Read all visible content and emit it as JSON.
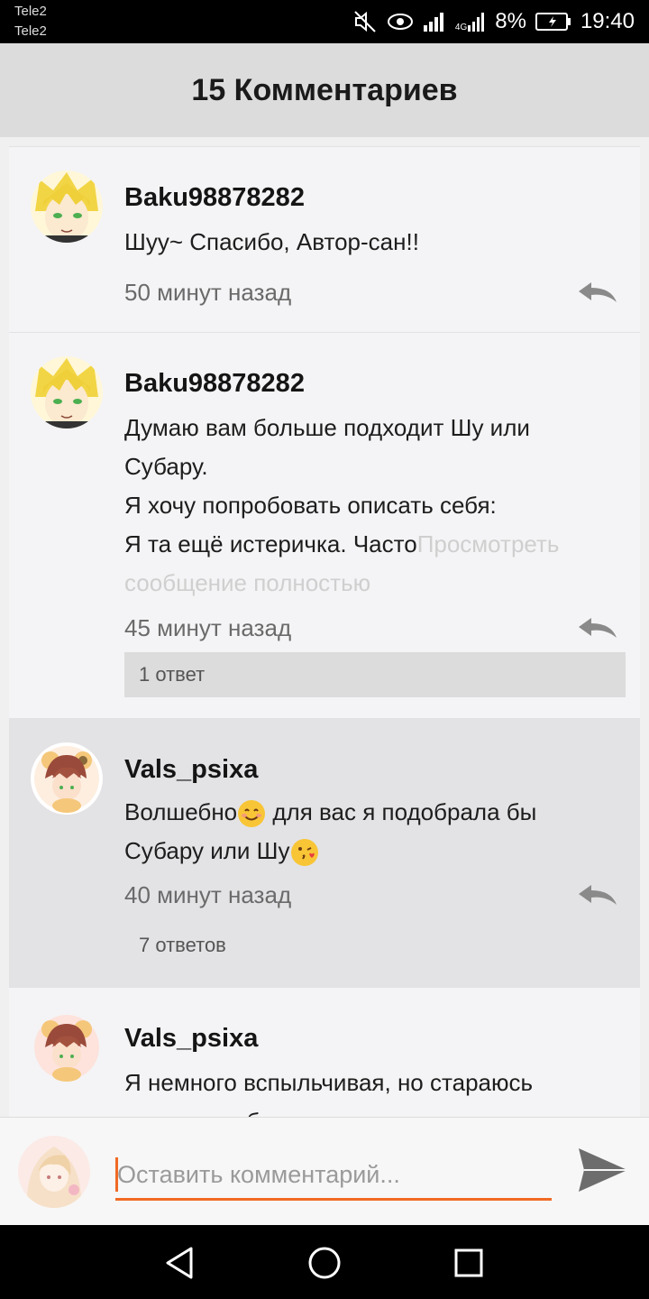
{
  "status_bar": {
    "carrier_1": "Tele2",
    "carrier_2": "Tele2",
    "network": "4G",
    "battery": "8%",
    "time": "19:40"
  },
  "header": {
    "title": "15 Комментариев"
  },
  "comments": [
    {
      "username": "Baku98878282",
      "text": "Шуу~ Спасибо, Автор-сан!!",
      "time": "50 минут назад"
    },
    {
      "username": "Baku98878282",
      "text_lines": [
        "Думаю вам больше подходит Шу или",
        "Субару.",
        "Я хочу попробовать описать себя:",
        "Я та ещё истеричка. Часто"
      ],
      "more_1": "Просмотреть",
      "more_2": "сообщение полностью",
      "time": "45 минут назад",
      "answers": "1 ответ"
    },
    {
      "username": "Vals_psixa",
      "text_line_1": "Волшебно",
      "text_line_1b": " для вас я подобрала бы",
      "text_line_2": "Субару или Шу",
      "time": "40 минут назад",
      "answers": "7 ответов"
    },
    {
      "username": "Vals_psixa",
      "text_line_1": "Я немного вспыльчивая, но стараюсь",
      "text_line_2": "держать себя в руках, часто меняется"
    }
  ],
  "input": {
    "placeholder": "Оставить комментарий..."
  },
  "colors": {
    "accent": "#f06a24",
    "header_bg": "#dcdcdc",
    "highlight_bg": "#e3e3e6"
  },
  "icons": {
    "reply": "reply-icon",
    "send": "send-icon",
    "back": "back-icon",
    "home": "home-icon",
    "recents": "recents-icon"
  }
}
